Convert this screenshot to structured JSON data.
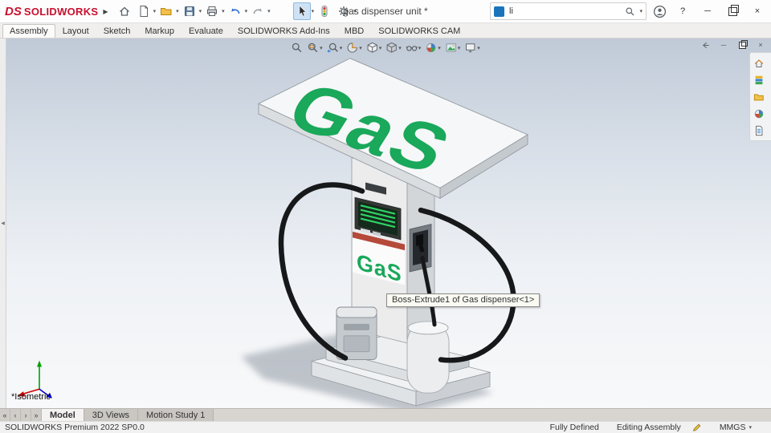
{
  "titlebar": {
    "brand": {
      "mark": "DS",
      "name": "SOLIDWORKS"
    },
    "doc_title": "gas dispenser unit *",
    "search_value": "li"
  },
  "icons": {
    "caret": "▾",
    "menu_arrow": "▶",
    "close": "×",
    "minimize": "─",
    "help": "?",
    "panel_collapse": "◀",
    "nav_first": "«",
    "nav_prev": "‹",
    "nav_next": "›",
    "nav_last": "»"
  },
  "colors": {
    "brand_red": "#c8102e",
    "decal_green": "#1aa85a",
    "stripe_red": "#b5493a"
  },
  "command_tabs": {
    "items": [
      {
        "label": "Assembly"
      },
      {
        "label": "Layout"
      },
      {
        "label": "Sketch"
      },
      {
        "label": "Markup"
      },
      {
        "label": "Evaluate"
      },
      {
        "label": "SOLIDWORKS Add-Ins"
      },
      {
        "label": "MBD"
      },
      {
        "label": "SOLIDWORKS CAM"
      }
    ]
  },
  "viewport": {
    "tooltip": "Boss-Extrude1 of Gas dispenser<1>",
    "orientation": "*Isometric",
    "decal": "GaS"
  },
  "bottom_bar": {
    "tabs": [
      {
        "label": "Model"
      },
      {
        "label": "3D Views"
      },
      {
        "label": "Motion Study 1"
      }
    ]
  },
  "statusbar": {
    "product": "SOLIDWORKS Premium 2022 SP0.0",
    "state": "Fully Defined",
    "mode": "Editing Assembly",
    "units": "MMGS"
  }
}
